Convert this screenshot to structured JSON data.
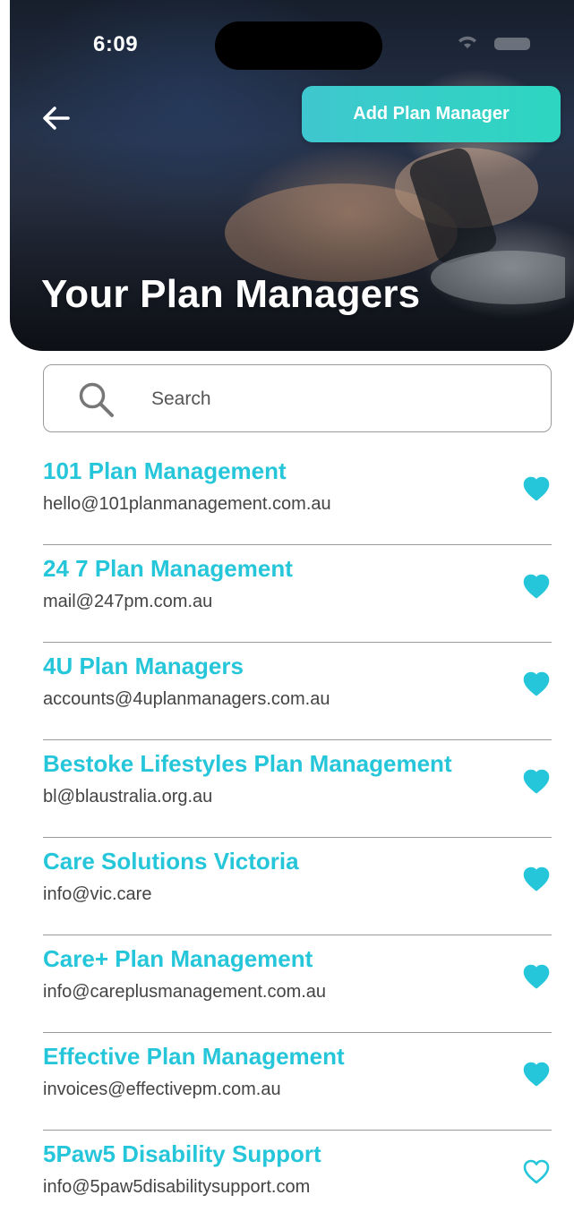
{
  "status_bar": {
    "time": "6:09",
    "icons": [
      "wifi-icon",
      "battery-icon"
    ]
  },
  "header": {
    "back_icon": "arrow-left-icon",
    "add_button_label": "Add Plan Manager",
    "title": "Your Plan Managers"
  },
  "search": {
    "placeholder": "Search",
    "value": "",
    "icon": "search-icon"
  },
  "colors": {
    "accent": "#26c6da",
    "button_gradient_start": "#3fc7cf",
    "button_gradient_end": "#2dd6c0",
    "divider": "#9a9a9a",
    "email_text": "#444444"
  },
  "managers": [
    {
      "name": "101 Plan Management",
      "email": "hello@101planmanagement.com.au",
      "favorite": true
    },
    {
      "name": "24 7 Plan Management",
      "email": "mail@247pm.com.au",
      "favorite": true
    },
    {
      "name": "4U Plan Managers",
      "email": "accounts@4uplanmanagers.com.au",
      "favorite": true
    },
    {
      "name": "Bestoke Lifestyles Plan Management",
      "email": "bl@blaustralia.org.au",
      "favorite": true
    },
    {
      "name": "Care Solutions Victoria",
      "email": "info@vic.care",
      "favorite": true
    },
    {
      "name": "Care+ Plan Management",
      "email": "info@careplusmanagement.com.au",
      "favorite": true
    },
    {
      "name": "Effective Plan Management",
      "email": "invoices@effectivepm.com.au",
      "favorite": true
    },
    {
      "name": "5Paw5 Disability Support",
      "email": "info@5paw5disabilitysupport.com",
      "favorite": false
    }
  ]
}
